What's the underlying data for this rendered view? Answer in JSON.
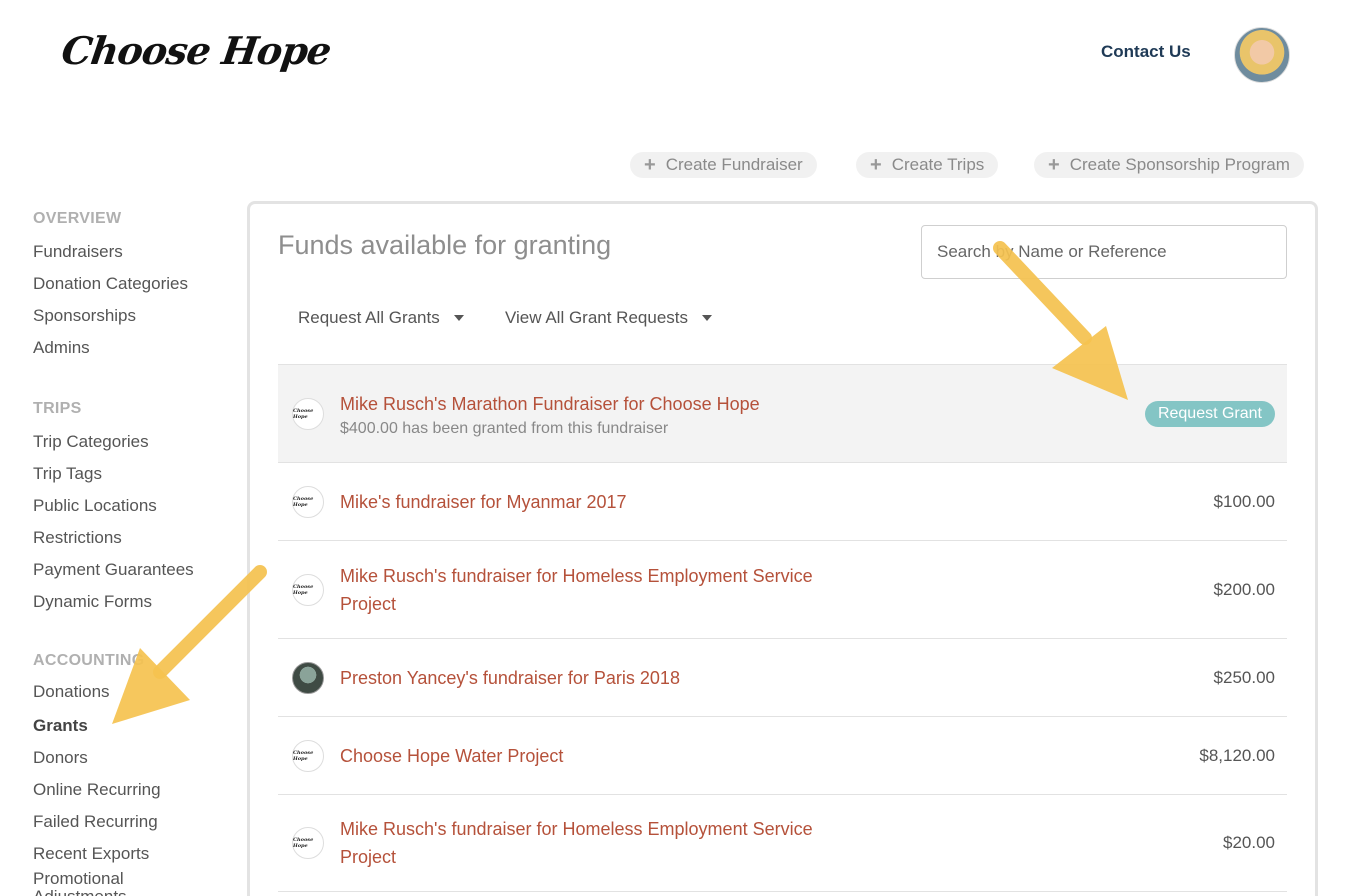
{
  "header": {
    "logo_text": "Choose Hope",
    "contact_label": "Contact Us"
  },
  "create_buttons": [
    {
      "label": "Create Fundraiser"
    },
    {
      "label": "Create Trips"
    },
    {
      "label": "Create Sponsorship Program"
    }
  ],
  "sidebar": {
    "sections": [
      {
        "title": "OVERVIEW",
        "items": [
          "Fundraisers",
          "Donation Categories",
          "Sponsorships",
          "Admins"
        ]
      },
      {
        "title": "TRIPS",
        "items": [
          "Trip Categories",
          "Trip Tags",
          "Public Locations",
          "Restrictions",
          "Payment Guarantees",
          "Dynamic Forms"
        ]
      },
      {
        "title": "ACCOUNTING",
        "items": [
          "Donations",
          "Grants",
          "Donors",
          "Online Recurring",
          "Failed Recurring",
          "Recent Exports",
          "Promotional Adjustments"
        ]
      }
    ],
    "active_item": "Grants"
  },
  "main": {
    "title": "Funds available for granting",
    "search_placeholder": "Search by Name or Reference",
    "dropdowns": [
      "Request All Grants",
      "View All Grant Requests"
    ],
    "rows": [
      {
        "name": "Mike Rusch's Marathon Fundraiser for Choose Hope",
        "sub": "$400.00 has been granted from this fundraiser",
        "action": "Request Grant"
      },
      {
        "name": "Mike's fundraiser for Myanmar 2017",
        "amount": "$100.00"
      },
      {
        "name": "Mike Rusch's fundraiser for Homeless Employment Service Project",
        "amount": "$200.00"
      },
      {
        "name": "Preston Yancey's fundraiser for Paris 2018",
        "amount": "$250.00"
      },
      {
        "name": "Choose Hope Water Project",
        "amount": "$8,120.00"
      },
      {
        "name": "Mike Rusch's fundraiser for Homeless Employment Service Project",
        "amount": "$20.00"
      }
    ]
  },
  "colors": {
    "accent_link": "#b5513a",
    "request_button": "#84c5c5",
    "arrow": "#f5c24f"
  }
}
